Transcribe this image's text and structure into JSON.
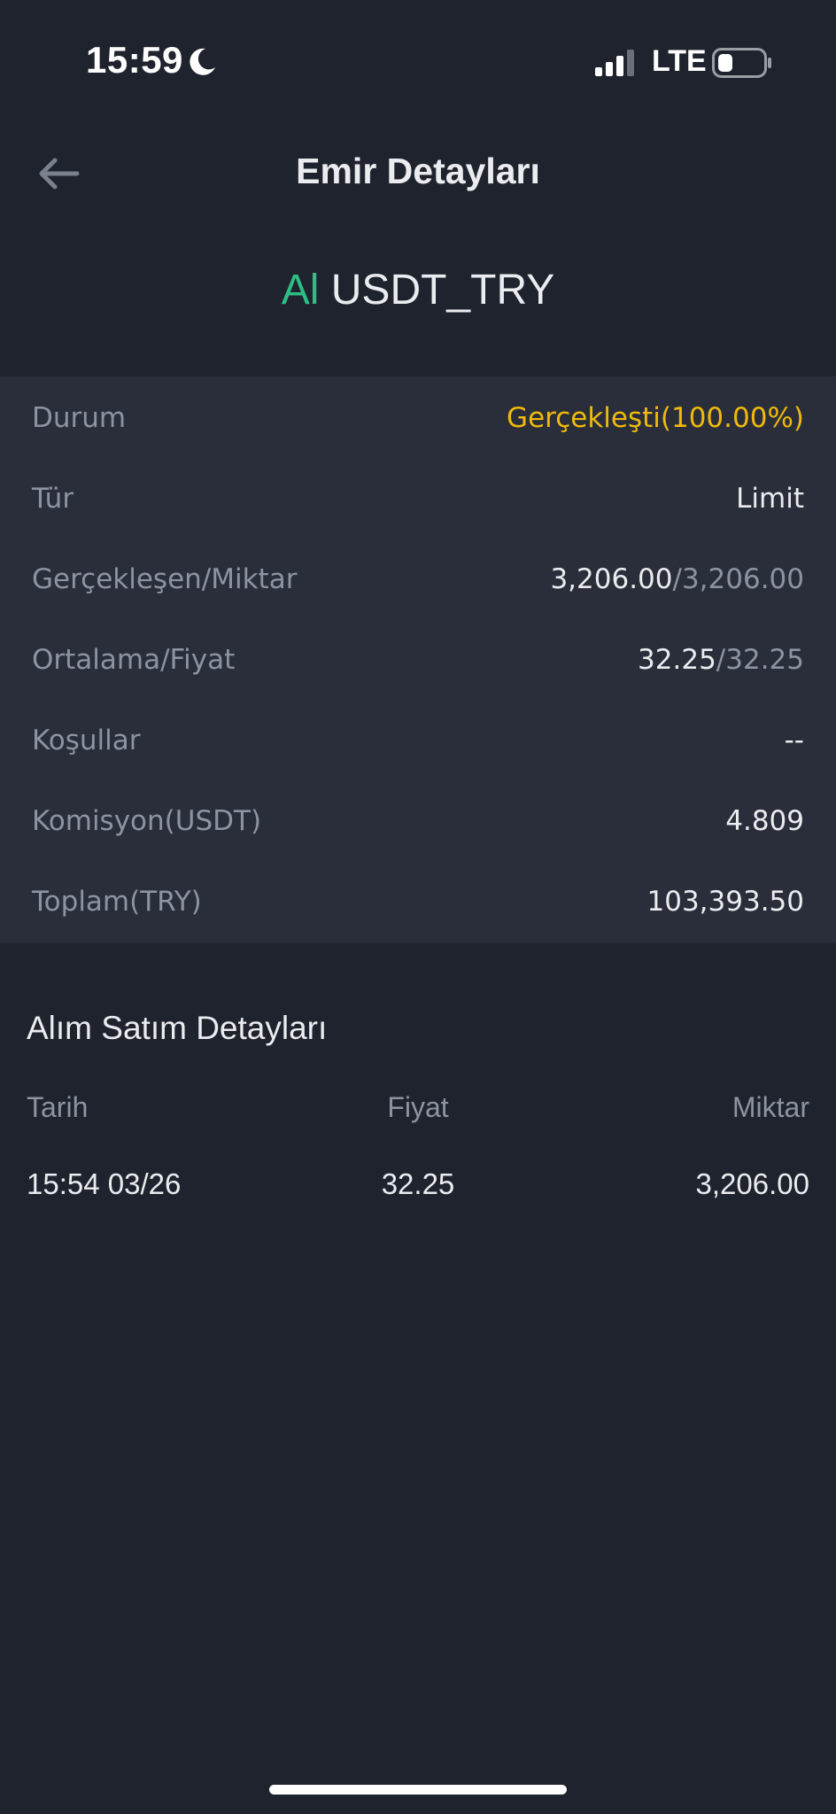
{
  "status_bar": {
    "time": "15:59",
    "network": "LTE"
  },
  "nav": {
    "title": "Emir Detayları"
  },
  "order": {
    "side": "Al",
    "pair": "USDT_TRY"
  },
  "details": {
    "status_label": "Durum",
    "status_value": "Gerçekleşti(100.00%)",
    "type_label": "Tür",
    "type_value": "Limit",
    "filled_label": "Gerçekleşen/Miktar",
    "filled_value": "3,206.00",
    "amount_value": "/3,206.00",
    "avg_label": "Ortalama/Fiyat",
    "avg_value": "32.25",
    "price_value": "/32.25",
    "conditions_label": "Koşullar",
    "conditions_value": "--",
    "fee_label": "Komisyon(USDT)",
    "fee_value": "4.809",
    "total_label": "Toplam(TRY)",
    "total_value": "103,393.50"
  },
  "trades": {
    "title": "Alım Satım Detayları",
    "headers": {
      "date": "Tarih",
      "price": "Fiyat",
      "amount": "Miktar"
    },
    "rows": [
      {
        "date": "15:54 03/26",
        "price": "32.25",
        "amount": "3,206.00"
      }
    ]
  },
  "colors": {
    "background": "#1f232d",
    "panel": "#292e3a",
    "buy_green": "#2ebd85",
    "status_yellow": "#f0b90b",
    "muted_text": "#8d93a0"
  }
}
